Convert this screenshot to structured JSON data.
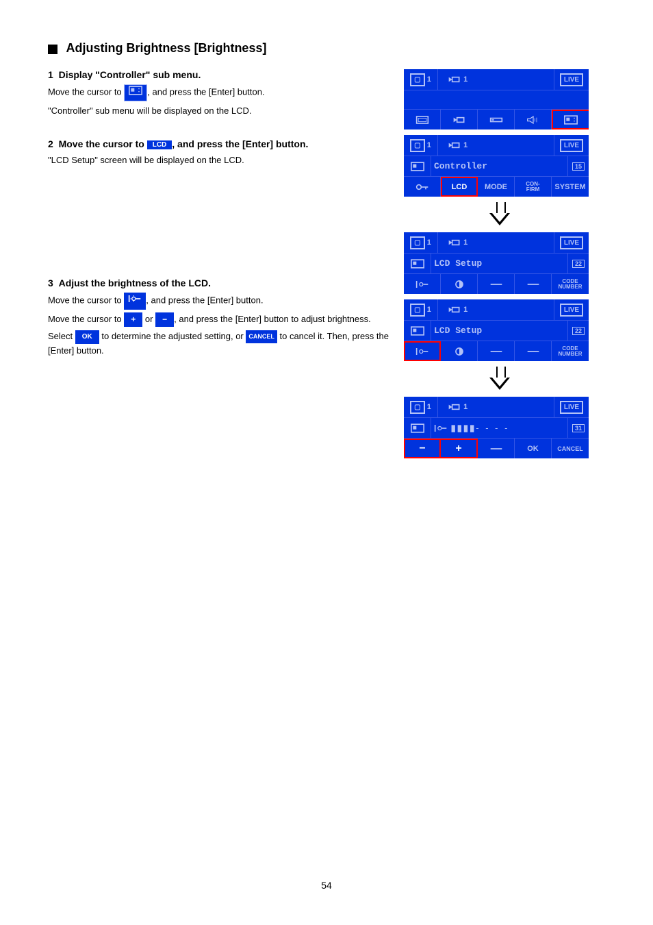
{
  "section": {
    "title": "Adjusting Brightness [Brightness]"
  },
  "steps": [
    {
      "num": "1",
      "title": "Display \"Controller\" sub menu.",
      "lines": [
        "Move the cursor to ICON_CTL, and press the [Enter] button.",
        "\"Controller\" sub menu will be displayed on the LCD."
      ]
    },
    {
      "num": "2",
      "title": "Move the cursor to ICON_LCD, and press the [Enter] button.",
      "lines": [
        "\"LCD Setup\" screen will be displayed on the LCD."
      ]
    },
    {
      "num": "3",
      "title": "Adjust the brightness of the LCD.",
      "lines": [
        "Move the cursor to ICON_BRIGHT, and press the [Enter] button.",
        "Move the cursor to ICON_PLUS or ICON_MINUS, and press the [Enter] button to adjust brightness.",
        "Select ICON_OK to determine the adjusted setting, or ICON_CANCEL to cancel it. Then, press the [Enter] button."
      ]
    }
  ],
  "icons": {
    "controller": "⊡",
    "lcd": "LCD",
    "brightness": "☼",
    "plus": "+",
    "minus": "−",
    "ok": "OK",
    "cancel": "CANCEL"
  },
  "screens": {
    "s1": {
      "row1": {
        "mon": "1",
        "cam": "1",
        "live": "LIVE"
      },
      "row3": {
        "items": [
          "monitor",
          "camera",
          "recorder",
          "speaker",
          "controller"
        ]
      }
    },
    "s2": {
      "row1": {
        "mon": "1",
        "cam": "1",
        "live": "LIVE"
      },
      "row2": {
        "title": "Controller",
        "badge": "15"
      },
      "row3": {
        "items": [
          "key",
          "LCD",
          "MODE",
          "CON-\nFIRM",
          "SYSTEM"
        ]
      }
    },
    "s3": {
      "row1": {
        "mon": "1",
        "cam": "1",
        "live": "LIVE"
      },
      "row2": {
        "title": "LCD Setup",
        "badge": "22"
      },
      "row3": {
        "items": [
          "brightness",
          "contrast",
          "",
          "",
          "CODE\nNUMBER"
        ]
      }
    },
    "s4": {
      "row1": {
        "mon": "1",
        "cam": "1",
        "live": "LIVE"
      },
      "row2": {
        "title": "LCD Setup",
        "badge": "22"
      },
      "row3": {
        "items": [
          "brightness",
          "contrast",
          "",
          "",
          "CODE\nNUMBER"
        ]
      }
    },
    "s5": {
      "row1": {
        "mon": "1",
        "cam": "1",
        "live": "LIVE"
      },
      "row2": {
        "level": "▮▮▮▮----",
        "badge": "31"
      },
      "row3": {
        "items": [
          "−",
          "+",
          "",
          "OK",
          "CANCEL"
        ]
      }
    }
  },
  "page_number": "54"
}
